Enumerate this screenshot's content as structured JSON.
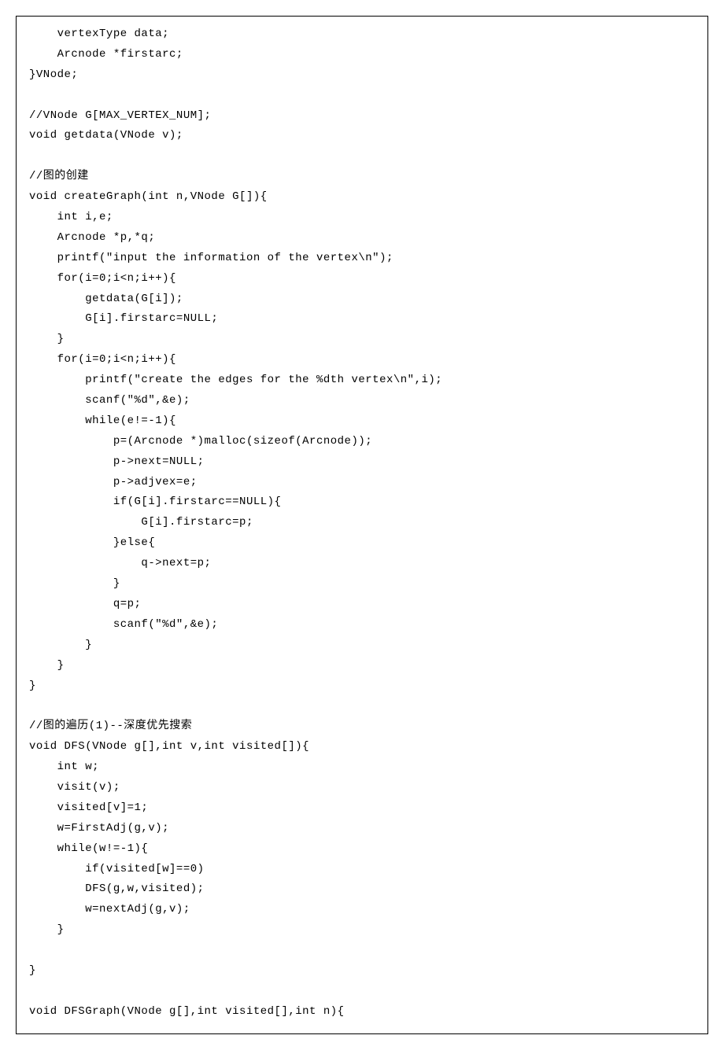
{
  "code": {
    "lines": [
      "    vertexType data;",
      "    Arcnode *firstarc;",
      "}VNode;",
      "",
      "//VNode G[MAX_VERTEX_NUM];",
      "void getdata(VNode v);",
      "",
      "//图的创建",
      "void createGraph(int n,VNode G[]){",
      "    int i,e;",
      "    Arcnode *p,*q;",
      "    printf(\"input the information of the vertex\\n\");",
      "    for(i=0;i<n;i++){",
      "        getdata(G[i]);",
      "        G[i].firstarc=NULL;",
      "    }",
      "    for(i=0;i<n;i++){",
      "        printf(\"create the edges for the %dth vertex\\n\",i);",
      "        scanf(\"%d\",&e);",
      "        while(e!=-1){",
      "            p=(Arcnode *)malloc(sizeof(Arcnode));",
      "            p->next=NULL;",
      "            p->adjvex=e;",
      "            if(G[i].firstarc==NULL){",
      "                G[i].firstarc=p;",
      "            }else{",
      "                q->next=p;",
      "            }",
      "            q=p;",
      "            scanf(\"%d\",&e);",
      "        }",
      "    }",
      "}",
      "",
      "//图的遍历(1)--深度优先搜索",
      "void DFS(VNode g[],int v,int visited[]){",
      "    int w;",
      "    visit(v);",
      "    visited[v]=1;",
      "    w=FirstAdj(g,v);",
      "    while(w!=-1){",
      "        if(visited[w]==0)",
      "        DFS(g,w,visited);",
      "        w=nextAdj(g,v);",
      "    }",
      "",
      "}",
      "",
      "void DFSGraph(VNode g[],int visited[],int n){"
    ]
  }
}
